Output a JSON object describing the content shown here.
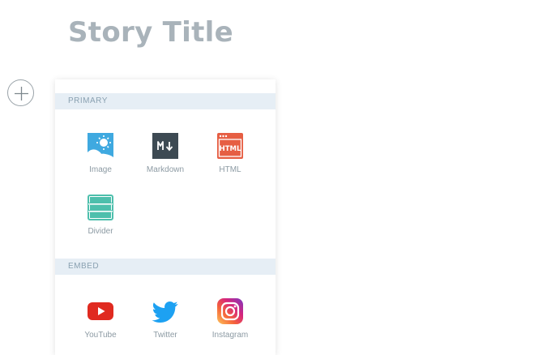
{
  "story": {
    "title": "Story Title"
  },
  "add_button": {
    "icon": "plus-icon"
  },
  "menu": {
    "primary": {
      "header": "PRIMARY",
      "items": [
        {
          "label": "Image",
          "icon": "image-icon",
          "color": "#3fa9e0"
        },
        {
          "label": "Markdown",
          "icon": "markdown-icon",
          "color": "#3d4a53"
        },
        {
          "label": "HTML",
          "icon": "html-icon",
          "color": "#e65e43"
        },
        {
          "label": "Divider",
          "icon": "divider-icon",
          "color": "#4dbfac"
        }
      ]
    },
    "embed": {
      "header": "EMBED",
      "items": [
        {
          "label": "YouTube",
          "icon": "youtube-icon",
          "color": "#e02a20"
        },
        {
          "label": "Twitter",
          "icon": "twitter-icon",
          "color": "#1da1f2"
        },
        {
          "label": "Instagram",
          "icon": "instagram-icon",
          "color": "#d6257c"
        }
      ]
    }
  }
}
